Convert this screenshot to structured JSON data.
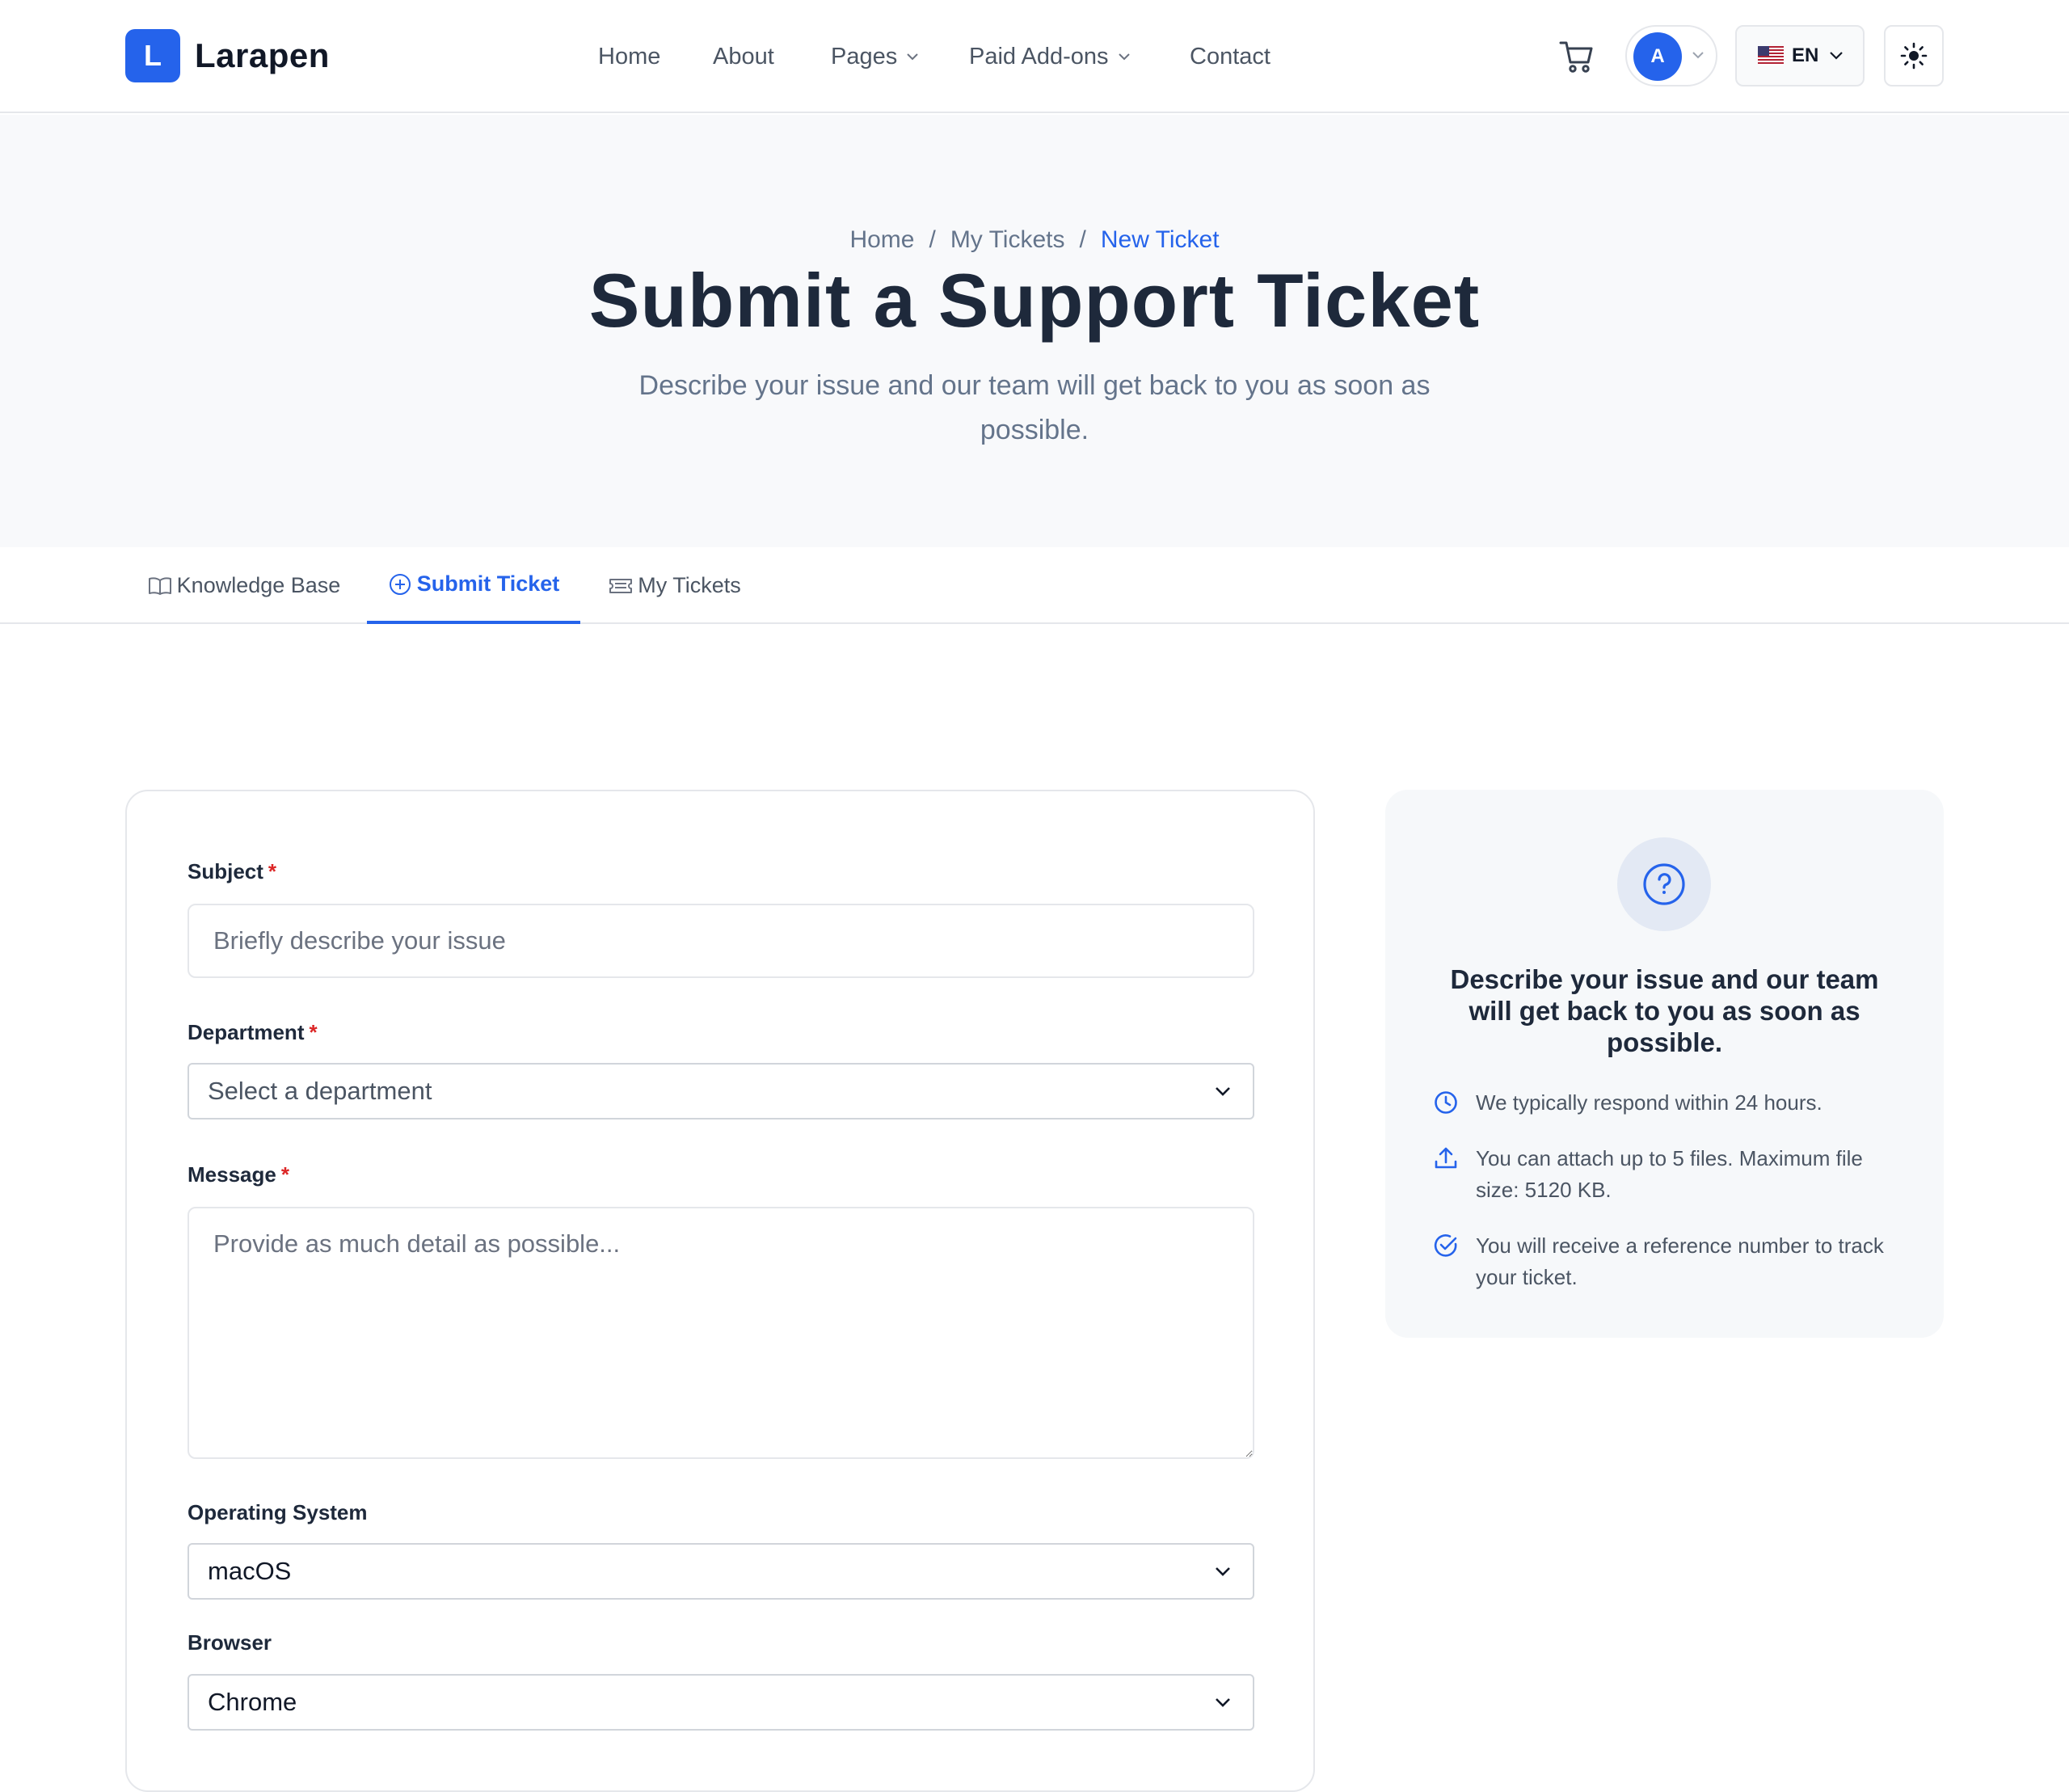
{
  "header": {
    "logo_letter": "L",
    "logo_text": "Larapen",
    "nav": [
      "Home",
      "About",
      "Pages",
      "Paid Add-ons",
      "Contact"
    ],
    "avatar_initial": "A",
    "language": "EN"
  },
  "hero": {
    "breadcrumb": [
      "Home",
      "My Tickets",
      "New Ticket"
    ],
    "title": "Submit a Support Ticket",
    "subtitle": "Describe your issue and our team will get back to you as soon as possible."
  },
  "tabs": [
    "Knowledge Base",
    "Submit Ticket",
    "My Tickets"
  ],
  "form": {
    "subject": {
      "label": "Subject",
      "required_mark": "*",
      "placeholder": "Briefly describe your issue"
    },
    "department": {
      "label": "Department",
      "required_mark": "*",
      "placeholder": "Select a department"
    },
    "message": {
      "label": "Message",
      "required_mark": "*",
      "placeholder": "Provide as much detail as possible..."
    },
    "os": {
      "label": "Operating System",
      "value": "macOS"
    },
    "browser": {
      "label": "Browser",
      "value": "Chrome"
    }
  },
  "info": {
    "title": "Describe your issue and our team will get back to you as soon as possible.",
    "items": [
      {
        "icon": "clock-icon",
        "text": "We typically respond within 24 hours."
      },
      {
        "icon": "upload-icon",
        "text": "You can attach up to 5 files. Maximum file size: 5120 KB."
      },
      {
        "icon": "check-circle-icon",
        "text": "You will receive a reference number to track your ticket."
      }
    ]
  },
  "colors": {
    "accent": "#2563eb",
    "required": "#dc2626",
    "text_dark": "#1e293b",
    "text_muted": "#64748b",
    "hero_bg": "#f8f9fb"
  }
}
